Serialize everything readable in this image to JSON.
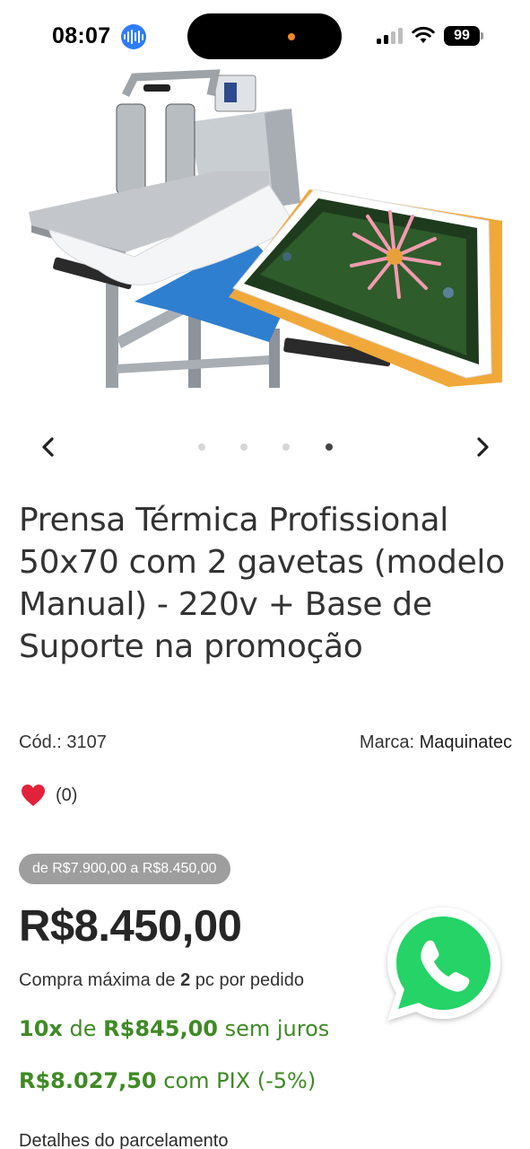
{
  "status_bar": {
    "time": "08:07",
    "battery": "99",
    "siri_icon": "voice-waveform-icon",
    "signal_icon": "cellular-signal-icon",
    "wifi_icon": "wifi-icon"
  },
  "product": {
    "image_alt_icon": "heat-press-product-image",
    "title": "Prensa Térmica Profissional 50x70 com 2 gavetas (modelo Manual) - 220v + Base de Suporte na promoção",
    "code_label": "Cód.:",
    "code_value": "3107",
    "brand_label": "Marca:",
    "brand_value": "Maquinatec",
    "favorites_count": "(0)",
    "price_range": "de R$7.900,00 a R$8.450,00",
    "price": "R$8.450,00",
    "max_purchase": {
      "prefix": "Compra máxima de",
      "quantity": "2",
      "suffix": "pc por pedido"
    },
    "installments": {
      "count": "10x",
      "connector": "de",
      "amount": "R$845,00",
      "suffix": "sem juros"
    },
    "pix": {
      "amount": "R$8.027,50",
      "suffix": "com PIX (-5%)"
    },
    "details_link": "Detalhes do parcelamento"
  },
  "carousel": {
    "total_slides": 4,
    "active_slide": 4,
    "prev_icon": "chevron-left-icon",
    "next_icon": "chevron-right-icon"
  },
  "colors": {
    "accent_green": "#3f8a25",
    "badge_gray": "#9e9e9e",
    "heart_red": "#e2223b",
    "whatsapp_green": "#25d366"
  }
}
